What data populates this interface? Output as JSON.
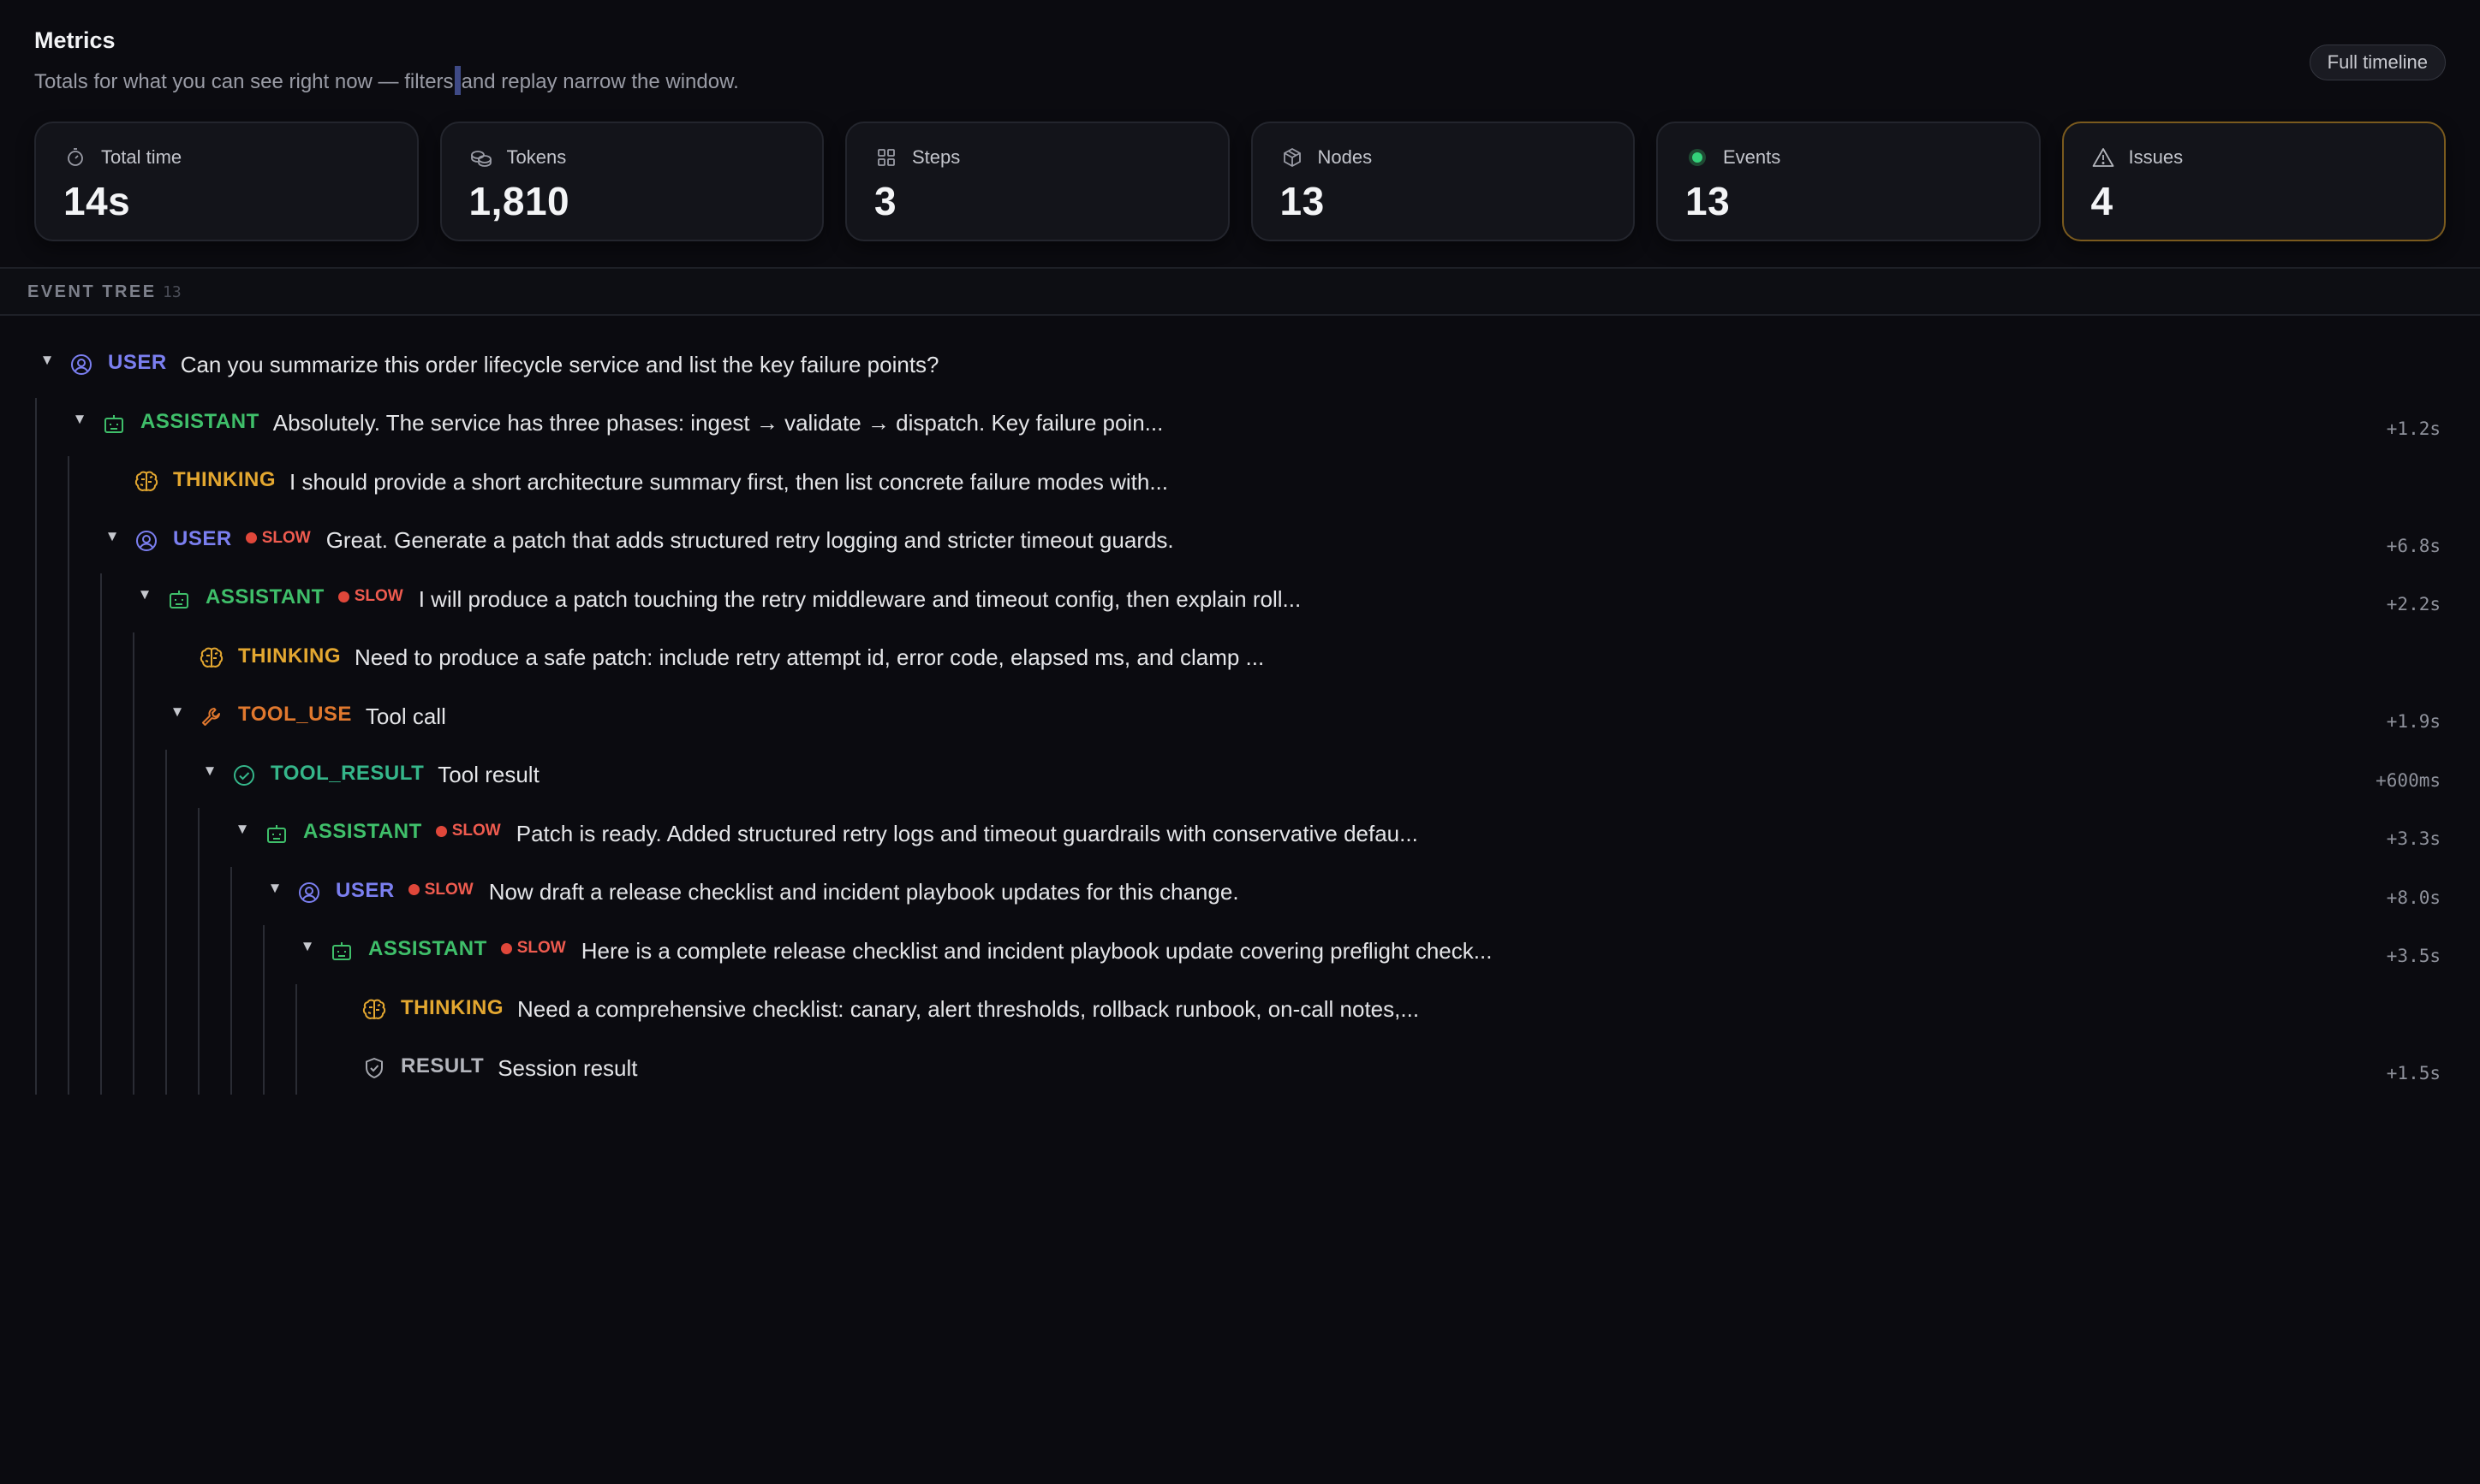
{
  "header": {
    "title": "Metrics",
    "subtitle_before": "Totals for what you can see right now — filters",
    "subtitle_after": "and replay narrow the window.",
    "timeline_button": "Full timeline"
  },
  "metrics": [
    {
      "label": "Total time",
      "value": "14s",
      "icon": "stopwatch-icon"
    },
    {
      "label": "Tokens",
      "value": "1,810",
      "icon": "coins-icon"
    },
    {
      "label": "Steps",
      "value": "3",
      "icon": "grid-icon"
    },
    {
      "label": "Nodes",
      "value": "13",
      "icon": "box-icon"
    },
    {
      "label": "Events",
      "value": "13",
      "icon": "status-dot-icon"
    },
    {
      "label": "Issues",
      "value": "4",
      "icon": "warning-triangle-icon"
    }
  ],
  "colors": {
    "user": "#7b7ff0",
    "assistant": "#3fbf6a",
    "thinking": "#e3a730",
    "tool_use": "#e0782e",
    "tool_result": "#35b68a",
    "result": "#b4b6bd",
    "slow": "#ef5b4f",
    "issues_border": "#7a5a1e",
    "events_dot": "#34d17a"
  },
  "event_tree": {
    "title": "EVENT TREE",
    "count": "13",
    "slow_label": "SLOW",
    "rows": [
      {
        "role": "USER",
        "kind": "user",
        "slow": false,
        "text": "Can you summarize this order lifecycle service and list the key failure points?",
        "duration": "",
        "expanded": true
      },
      {
        "role": "ASSISTANT",
        "kind": "assistant",
        "slow": false,
        "text": "Absolutely. The service has three phases: ingest → validate → dispatch. Key failure poin...",
        "duration": "+1.2s",
        "expanded": true
      },
      {
        "role": "THINKING",
        "kind": "thinking",
        "slow": false,
        "text": "I should provide a short architecture summary first, then list concrete failure modes with...",
        "duration": "",
        "expanded": null
      },
      {
        "role": "USER",
        "kind": "user",
        "slow": true,
        "text": "Great. Generate a patch that adds structured retry logging and stricter timeout guards.",
        "duration": "+6.8s",
        "expanded": true
      },
      {
        "role": "ASSISTANT",
        "kind": "assistant",
        "slow": true,
        "text": "I will produce a patch touching the retry middleware and timeout config, then explain roll...",
        "duration": "+2.2s",
        "expanded": true
      },
      {
        "role": "THINKING",
        "kind": "thinking",
        "slow": false,
        "text": "Need to produce a safe patch: include retry attempt id, error code, elapsed ms, and clamp ...",
        "duration": "",
        "expanded": null
      },
      {
        "role": "TOOL_USE",
        "kind": "tool_use",
        "slow": false,
        "text": "Tool call",
        "duration": "+1.9s",
        "expanded": true
      },
      {
        "role": "TOOL_RESULT",
        "kind": "tool_result",
        "slow": false,
        "text": "Tool result",
        "duration": "+600ms",
        "expanded": true
      },
      {
        "role": "ASSISTANT",
        "kind": "assistant",
        "slow": true,
        "text": "Patch is ready. Added structured retry logs and timeout guardrails with conservative defau...",
        "duration": "+3.3s",
        "expanded": true
      },
      {
        "role": "USER",
        "kind": "user",
        "slow": true,
        "text": "Now draft a release checklist and incident playbook updates for this change.",
        "duration": "+8.0s",
        "expanded": true
      },
      {
        "role": "ASSISTANT",
        "kind": "assistant",
        "slow": true,
        "text": "Here is a complete release checklist and incident playbook update covering preflight check...",
        "duration": "+3.5s",
        "expanded": true
      },
      {
        "role": "THINKING",
        "kind": "thinking",
        "slow": false,
        "text": "Need a comprehensive checklist: canary, alert thresholds, rollback runbook, on-call notes,...",
        "duration": "",
        "expanded": null
      },
      {
        "role": "RESULT",
        "kind": "result",
        "slow": false,
        "text": "Session result",
        "duration": "+1.5s",
        "expanded": null
      }
    ]
  }
}
